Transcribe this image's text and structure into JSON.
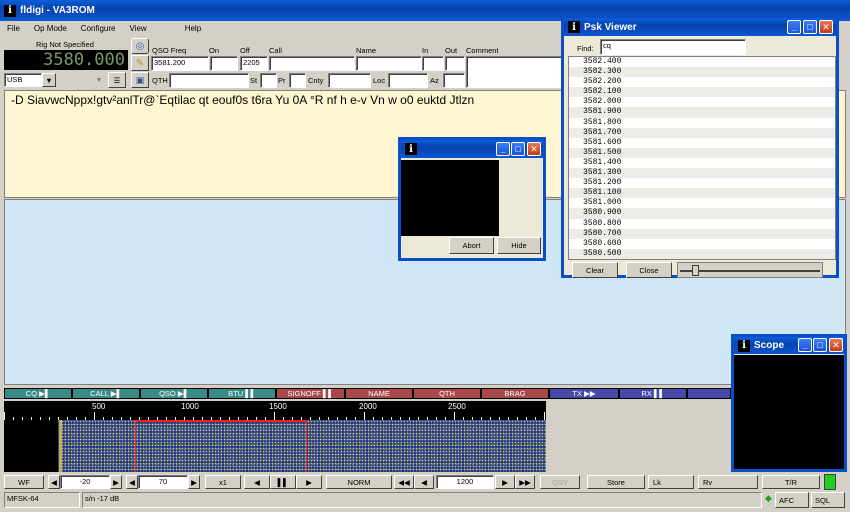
{
  "app": {
    "title": "fldigi - VA3ROM"
  },
  "menu": [
    "File",
    "Op Mode",
    "Configure",
    "View",
    "Help"
  ],
  "rig": {
    "label": "Rig Not Specified",
    "freq": "3580.000",
    "mode": "USB"
  },
  "qso": {
    "freq_label": "QSO Freq",
    "freq_value": "3581.200",
    "on_label": "On",
    "on_value": "",
    "off_label": "Off",
    "off_value": "2205",
    "call_label": "Call",
    "name_label": "Name",
    "in_label": "In",
    "out_label": "Out",
    "comment_label": "Comment",
    "qth_label": "QTH",
    "st_label": "St",
    "pr_label": "Pr",
    "cnty_label": "Cnty",
    "loc_label": "Loc",
    "az_label": "Az"
  },
  "rx_text": "-D SiavwcNppx!gtv²anlTr@`Eqtilac qt eouf0s t6ra Yu 0A  °R nf h e-v Vn w o0 euktd Jtlzn",
  "small_dialog": {
    "abort_label": "Abort",
    "hide_label": "Hide"
  },
  "psk_viewer": {
    "title": "Psk Viewer",
    "find_label": "Find:",
    "find_value": "cq",
    "frequencies": [
      "3582.400",
      "3582.300",
      "3582.200",
      "3582.100",
      "3582.000",
      "3581.900",
      "3581.800",
      "3581.700",
      "3581.600",
      "3581.500",
      "3581.400",
      "3581.300",
      "3581.200",
      "3581.100",
      "3581.000",
      "3580.900",
      "3580.800",
      "3580.700",
      "3580.600",
      "3580.500"
    ],
    "clear_label": "Clear",
    "close_label": "Close"
  },
  "scope": {
    "title": "Scope"
  },
  "macros": [
    {
      "label": "CQ ▶▌",
      "color": "#3a8a8a"
    },
    {
      "label": "CALL ▶▌",
      "color": "#3a8a8a"
    },
    {
      "label": "QSO ▶▌",
      "color": "#3a8a8a"
    },
    {
      "label": "BTU ▌▌",
      "color": "#3a8a8a"
    },
    {
      "label": "SIGNOFF ▌▌",
      "color": "#a84848"
    },
    {
      "label": "NAME",
      "color": "#a84848"
    },
    {
      "label": "QTH",
      "color": "#a84848"
    },
    {
      "label": "BRAG",
      "color": "#a84848"
    },
    {
      "label": "TX ▶▶",
      "color": "#4848a8"
    },
    {
      "label": "RX ▌▌",
      "color": "#4848a8"
    },
    {
      "label": "",
      "color": "#4848a8"
    }
  ],
  "ruler": {
    "labels": [
      "500",
      "1000",
      "1500",
      "2000",
      "2500"
    ]
  },
  "controls": {
    "wf_label": "WF",
    "ref_level": "-20",
    "range": "70",
    "zoom": "x1",
    "speed": "NORM",
    "cursor_freq": "1200",
    "qsy_label": "QSY",
    "store_label": "Store",
    "lk_label": "Lk",
    "rv_label": "Rv",
    "tr_label": "T/R"
  },
  "status": {
    "mode": "MFSK-64",
    "sn": "s/n -17 dB",
    "afc_label": "AFC",
    "sql_label": "SQL"
  }
}
